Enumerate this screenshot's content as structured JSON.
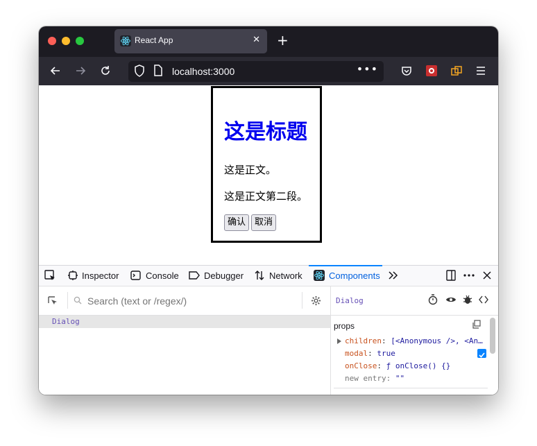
{
  "browser": {
    "tab_title": "React App",
    "tab_close": "✕",
    "new_tab": "+",
    "url": "localhost:3000",
    "url_more": "•••"
  },
  "dialog": {
    "heading": "这是标题",
    "paragraph1": "这是正文。",
    "paragraph2": "这是正文第二段。",
    "confirm_label": "确认",
    "cancel_label": "取消"
  },
  "devtools": {
    "tabs": {
      "inspector": "Inspector",
      "console": "Console",
      "debugger": "Debugger",
      "network": "Network",
      "components": "Components"
    },
    "search_placeholder": "Search (text or /regex/)",
    "tree": [
      "Dialog"
    ],
    "selected_component": "Dialog",
    "props_title": "props",
    "props": [
      {
        "key": "children",
        "value": "[<Anonymous />, <An…"
      },
      {
        "key": "modal",
        "value": "true"
      },
      {
        "key": "onClose",
        "value": "ƒ onClose() {}"
      }
    ],
    "new_entry_label": "new entry:",
    "new_entry_value": "\"\""
  },
  "colors": {
    "heading": "#0000ee",
    "accent": "#0a84ff",
    "component_name": "#6650b6",
    "prop_key": "#c8521e"
  }
}
